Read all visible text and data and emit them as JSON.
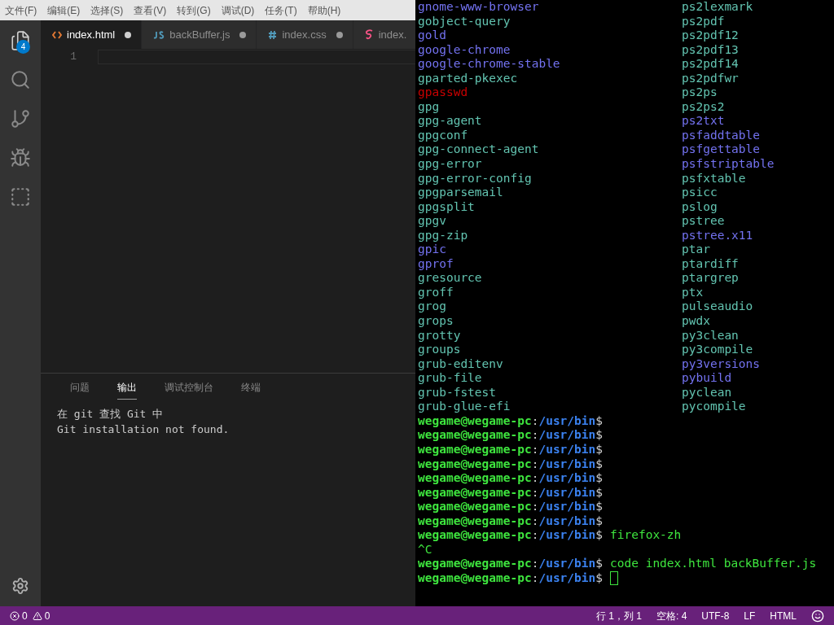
{
  "menu": [
    "文件(F)",
    "编辑(E)",
    "选择(S)",
    "查看(V)",
    "转到(G)",
    "调试(D)",
    "任务(T)",
    "帮助(H)"
  ],
  "activity_bar": {
    "explorer_badge": "4"
  },
  "tabs": [
    {
      "label": "index.html",
      "kind": "html",
      "selected": true,
      "dirty": true
    },
    {
      "label": "backBuffer.js",
      "kind": "js",
      "selected": false,
      "dirty": true
    },
    {
      "label": "index.css",
      "kind": "css",
      "selected": false,
      "dirty": true
    },
    {
      "label": "index.",
      "kind": "sass",
      "selected": false,
      "dirty": false
    }
  ],
  "editor": {
    "line_numbers": [
      "1"
    ]
  },
  "panel": {
    "tabs": [
      {
        "label": "问题",
        "selected": false
      },
      {
        "label": "输出",
        "selected": true
      },
      {
        "label": "调试控制台",
        "selected": false
      },
      {
        "label": "终端",
        "selected": false
      }
    ],
    "output": [
      "在 git 查找 Git 中",
      "Git installation not found."
    ]
  },
  "status_bar": {
    "errors": "0",
    "warnings": "0",
    "items": [
      "行 1，列 1",
      "空格: 4",
      "UTF-8",
      "LF",
      "HTML"
    ]
  },
  "terminal": {
    "listing": [
      [
        {
          "name": "gnome-www-browser",
          "kind": "link"
        },
        {
          "name": "ps2lexmark",
          "kind": "exec"
        }
      ],
      [
        {
          "name": "gobject-query",
          "kind": "exec"
        },
        {
          "name": "ps2pdf",
          "kind": "exec"
        }
      ],
      [
        {
          "name": "gold",
          "kind": "link"
        },
        {
          "name": "ps2pdf12",
          "kind": "exec"
        }
      ],
      [
        {
          "name": "google-chrome",
          "kind": "link"
        },
        {
          "name": "ps2pdf13",
          "kind": "exec"
        }
      ],
      [
        {
          "name": "google-chrome-stable",
          "kind": "link"
        },
        {
          "name": "ps2pdf14",
          "kind": "exec"
        }
      ],
      [
        {
          "name": "gparted-pkexec",
          "kind": "exec"
        },
        {
          "name": "ps2pdfwr",
          "kind": "exec"
        }
      ],
      [
        {
          "name": "gpasswd",
          "kind": "setuid"
        },
        {
          "name": "ps2ps",
          "kind": "exec"
        }
      ],
      [
        {
          "name": "gpg",
          "kind": "exec"
        },
        {
          "name": "ps2ps2",
          "kind": "exec"
        }
      ],
      [
        {
          "name": "gpg-agent",
          "kind": "exec"
        },
        {
          "name": "ps2txt",
          "kind": "link"
        }
      ],
      [
        {
          "name": "gpgconf",
          "kind": "exec"
        },
        {
          "name": "psfaddtable",
          "kind": "link"
        }
      ],
      [
        {
          "name": "gpg-connect-agent",
          "kind": "exec"
        },
        {
          "name": "psfgettable",
          "kind": "link"
        }
      ],
      [
        {
          "name": "gpg-error",
          "kind": "exec"
        },
        {
          "name": "psfstriptable",
          "kind": "link"
        }
      ],
      [
        {
          "name": "gpg-error-config",
          "kind": "exec"
        },
        {
          "name": "psfxtable",
          "kind": "exec"
        }
      ],
      [
        {
          "name": "gpgparsemail",
          "kind": "exec"
        },
        {
          "name": "psicc",
          "kind": "exec"
        }
      ],
      [
        {
          "name": "gpgsplit",
          "kind": "exec"
        },
        {
          "name": "pslog",
          "kind": "exec"
        }
      ],
      [
        {
          "name": "gpgv",
          "kind": "exec"
        },
        {
          "name": "pstree",
          "kind": "exec"
        }
      ],
      [
        {
          "name": "gpg-zip",
          "kind": "exec"
        },
        {
          "name": "pstree.x11",
          "kind": "link"
        }
      ],
      [
        {
          "name": "gpic",
          "kind": "link"
        },
        {
          "name": "ptar",
          "kind": "exec"
        }
      ],
      [
        {
          "name": "gprof",
          "kind": "link"
        },
        {
          "name": "ptardiff",
          "kind": "exec"
        }
      ],
      [
        {
          "name": "gresource",
          "kind": "exec"
        },
        {
          "name": "ptargrep",
          "kind": "exec"
        }
      ],
      [
        {
          "name": "groff",
          "kind": "exec"
        },
        {
          "name": "ptx",
          "kind": "exec"
        }
      ],
      [
        {
          "name": "grog",
          "kind": "exec"
        },
        {
          "name": "pulseaudio",
          "kind": "exec"
        }
      ],
      [
        {
          "name": "grops",
          "kind": "exec"
        },
        {
          "name": "pwdx",
          "kind": "exec"
        }
      ],
      [
        {
          "name": "grotty",
          "kind": "exec"
        },
        {
          "name": "py3clean",
          "kind": "exec"
        }
      ],
      [
        {
          "name": "groups",
          "kind": "exec"
        },
        {
          "name": "py3compile",
          "kind": "exec"
        }
      ],
      [
        {
          "name": "grub-editenv",
          "kind": "exec"
        },
        {
          "name": "py3versions",
          "kind": "link"
        }
      ],
      [
        {
          "name": "grub-file",
          "kind": "exec"
        },
        {
          "name": "pybuild",
          "kind": "link"
        }
      ],
      [
        {
          "name": "grub-fstest",
          "kind": "exec"
        },
        {
          "name": "pyclean",
          "kind": "exec"
        }
      ],
      [
        {
          "name": "grub-glue-efi",
          "kind": "exec"
        },
        {
          "name": "pycompile",
          "kind": "exec"
        }
      ]
    ],
    "lines": [
      {
        "kind": "prompt",
        "user": "wegame@wegame-pc",
        "colon": ":",
        "path": "/usr/bin",
        "sign": "$"
      },
      {
        "kind": "prompt",
        "user": "wegame@wegame-pc",
        "colon": ":",
        "path": "/usr/bin",
        "sign": "$"
      },
      {
        "kind": "prompt",
        "user": "wegame@wegame-pc",
        "colon": ":",
        "path": "/usr/bin",
        "sign": "$"
      },
      {
        "kind": "prompt",
        "user": "wegame@wegame-pc",
        "colon": ":",
        "path": "/usr/bin",
        "sign": "$"
      },
      {
        "kind": "prompt",
        "user": "wegame@wegame-pc",
        "colon": ":",
        "path": "/usr/bin",
        "sign": "$"
      },
      {
        "kind": "prompt",
        "user": "wegame@wegame-pc",
        "colon": ":",
        "path": "/usr/bin",
        "sign": "$"
      },
      {
        "kind": "prompt",
        "user": "wegame@wegame-pc",
        "colon": ":",
        "path": "/usr/bin",
        "sign": "$"
      },
      {
        "kind": "prompt",
        "user": "wegame@wegame-pc",
        "colon": ":",
        "path": "/usr/bin",
        "sign": "$"
      },
      {
        "kind": "prompt",
        "user": "wegame@wegame-pc",
        "colon": ":",
        "path": "/usr/bin",
        "sign": "$",
        "command": "firefox-zh"
      },
      {
        "kind": "output",
        "text": "^C"
      },
      {
        "kind": "prompt",
        "user": "wegame@wegame-pc",
        "colon": ":",
        "path": "/usr/bin",
        "sign": "$",
        "command": "code index.html backBuffer.js"
      },
      {
        "kind": "prompt",
        "user": "wegame@wegame-pc",
        "colon": ":",
        "path": "/usr/bin",
        "sign": "$",
        "cursor": true
      }
    ]
  }
}
